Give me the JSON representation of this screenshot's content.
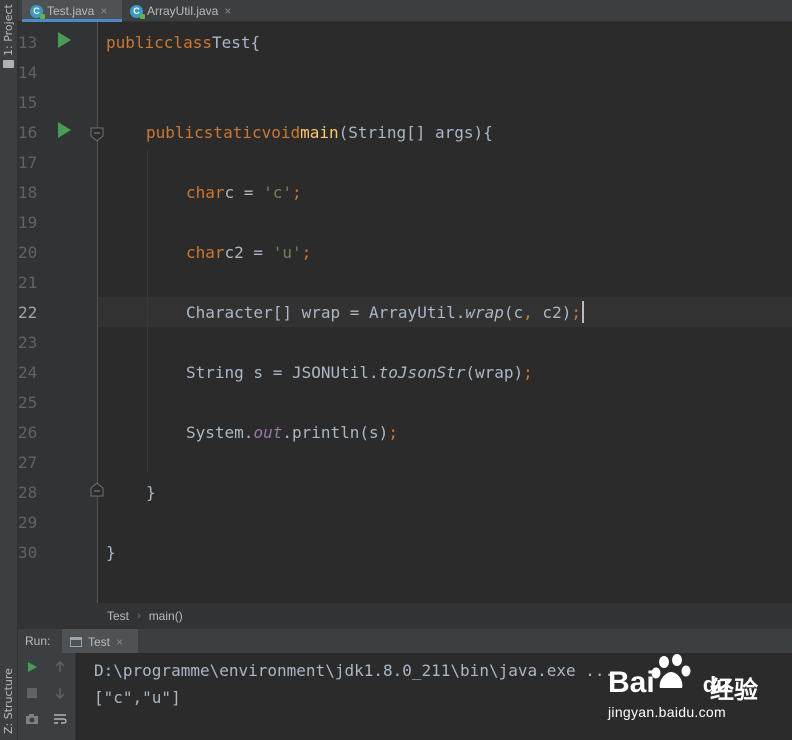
{
  "tool_windows": {
    "project": "1: Project",
    "structure": "Z: Structure"
  },
  "editor_tabs": [
    {
      "label": "Test.java",
      "icon": "java-class-icon",
      "active": true
    },
    {
      "label": "ArrayUtil.java",
      "icon": "java-class-icon",
      "active": false
    }
  ],
  "code": {
    "line_numbers": [
      "13",
      "14",
      "15",
      "16",
      "17",
      "18",
      "19",
      "20",
      "21",
      "22",
      "23",
      "24",
      "25",
      "26",
      "27",
      "28",
      "29",
      "30"
    ],
    "current_line": "22",
    "lines": {
      "l13": {
        "kw1": "public",
        "kw2": "class",
        "name": "Test",
        "brace": "{"
      },
      "l16": {
        "kw1": "public",
        "kw2": "static",
        "kw3": "void",
        "fn": "main",
        "params": "(String[] args){"
      },
      "l18": {
        "kw": "char",
        "rest": "c = ",
        "str": "'c'",
        "end": ";"
      },
      "l20": {
        "kw": "char",
        "rest": "c2 = ",
        "str": "'u'",
        "end": ";"
      },
      "l22": {
        "a": "Character[] wrap = ArrayUtil.",
        "m": "wrap",
        "b": "(c",
        "comma": ",",
        "c": " c2)",
        "end": ";"
      },
      "l24": {
        "a": "String s = JSONUtil.",
        "m": "toJsonStr",
        "b": "(wrap)",
        "end": ";"
      },
      "l26": {
        "a": "System.",
        "f": "out",
        "b": ".println(s)",
        "end": ";"
      },
      "l28": {
        "brace": "}"
      },
      "l30": {
        "brace": "}"
      }
    }
  },
  "breadcrumb": [
    "Test",
    "main()"
  ],
  "run_panel": {
    "label": "Run:",
    "tab": "Test",
    "console_lines": [
      "D:\\programme\\environment\\jdk1.8.0_211\\bin\\java.exe ...",
      "[\"c\",\"u\"]"
    ]
  },
  "watermark": {
    "brand": "Bai",
    "brand_suffix": "du",
    "chinese": "经验",
    "url": "jingyan.baidu.com"
  },
  "colors": {
    "keyword": "#cc7832",
    "function": "#ffc66d",
    "string": "#6a8759",
    "field": "#9876aa",
    "text": "#a9b7c6",
    "run_green": "#499c54",
    "tab_underline": "#4a88c7"
  }
}
